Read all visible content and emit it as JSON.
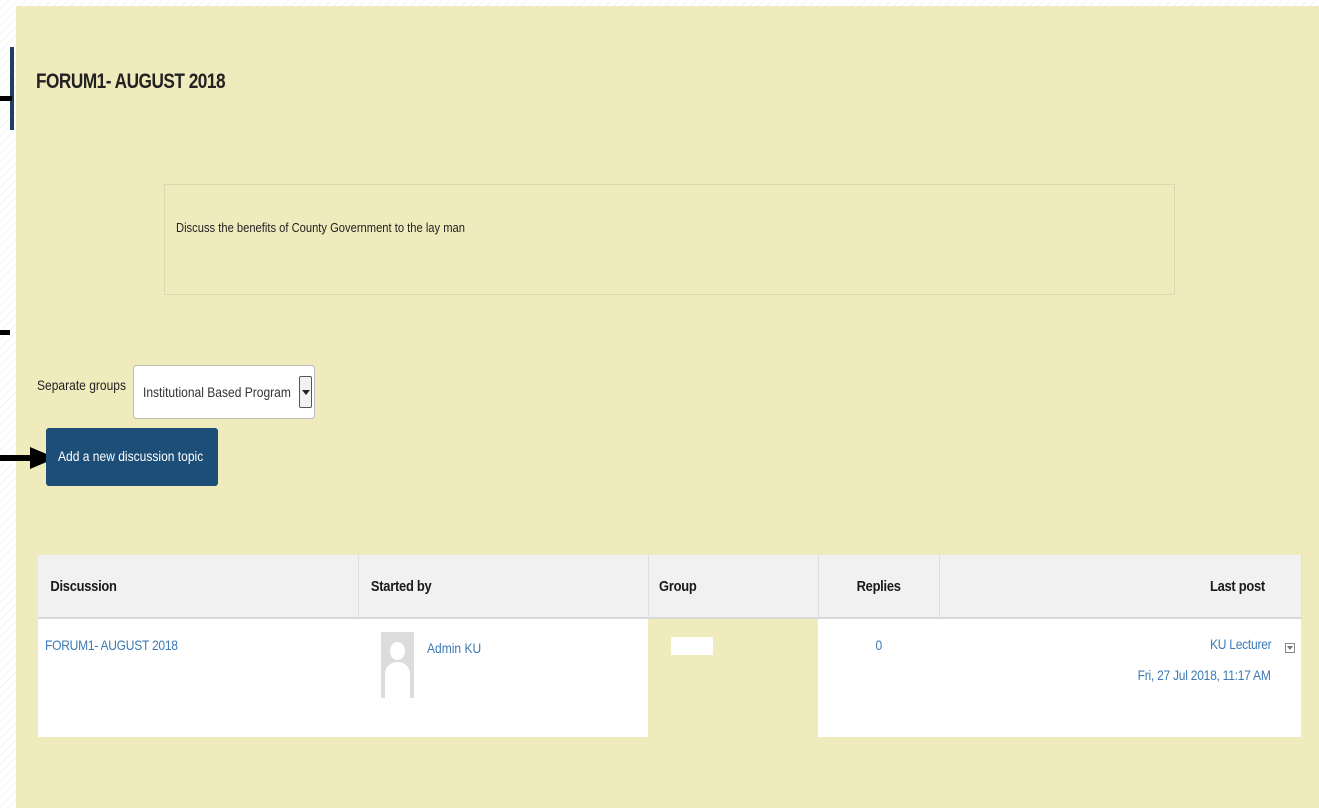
{
  "page": {
    "title": "FORUM1- AUGUST 2018",
    "intro": "Discuss the benefits of County Government to the lay man"
  },
  "groups": {
    "label": "Separate groups",
    "selected": "Institutional Based Program"
  },
  "actions": {
    "add_topic_label": "Add a new discussion topic"
  },
  "table": {
    "headers": {
      "discussion": "Discussion",
      "started_by": "Started by",
      "group": "Group",
      "replies": "Replies",
      "last_post": "Last post"
    },
    "rows": [
      {
        "discussion": "FORUM1- AUGUST 2018",
        "started_by": "Admin KU",
        "group": "",
        "replies": "0",
        "last_post_author": "KU Lecturer",
        "last_post_date": "Fri, 27 Jul 2018, 11:17 AM"
      }
    ]
  },
  "colors": {
    "panel_bg": "#efebbd",
    "button_bg": "#1d4e78",
    "link": "#3c79b5"
  }
}
